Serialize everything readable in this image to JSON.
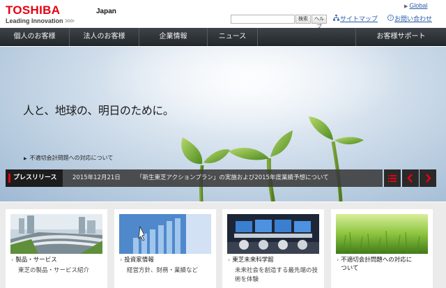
{
  "header": {
    "logo_text": "TOSHIBA",
    "logo_tagline": "Leading Innovation",
    "logo_tagline_arrows": ">>>",
    "region": "Japan",
    "global_link": "Global",
    "search": {
      "value": "",
      "placeholder": "",
      "button_label": "検索",
      "help_label": "ヘルプ"
    },
    "sitemap_link": "サイトマップ",
    "contact_link": "お問い合わせ"
  },
  "nav": {
    "items": [
      "個人のお客様",
      "法人のお客様",
      "企業情報",
      "ニュース"
    ],
    "support": "お客様サポート"
  },
  "hero": {
    "title": "人と、地球の、明日のために。",
    "notice": "不適切会計問題への対応について"
  },
  "press": {
    "label": "プレスリリース",
    "date": "2015年12月21日",
    "text": "「新生東芝アクションプラン」の実施および2015年度業績予想について"
  },
  "cards": [
    {
      "title": "製品・サービス",
      "desc": "東芝の製品・サービス紹介"
    },
    {
      "title": "投資家情報",
      "desc": "経営方針、財務・業績など"
    },
    {
      "title": "東芝未来科学館",
      "desc": "未来社会を創造する最先端の技術を体験"
    },
    {
      "title": "不適切会計問題への対応について",
      "desc": ""
    }
  ],
  "colors": {
    "brand_red": "#e60012",
    "nav_bg": "#2e3438",
    "link_blue": "#2a5aa8"
  },
  "icons": [
    "triangle-right-icon",
    "sitemap-icon",
    "contact-icon",
    "list-icon",
    "chevron-left-icon",
    "chevron-right-icon",
    "chevron-right-icon"
  ]
}
